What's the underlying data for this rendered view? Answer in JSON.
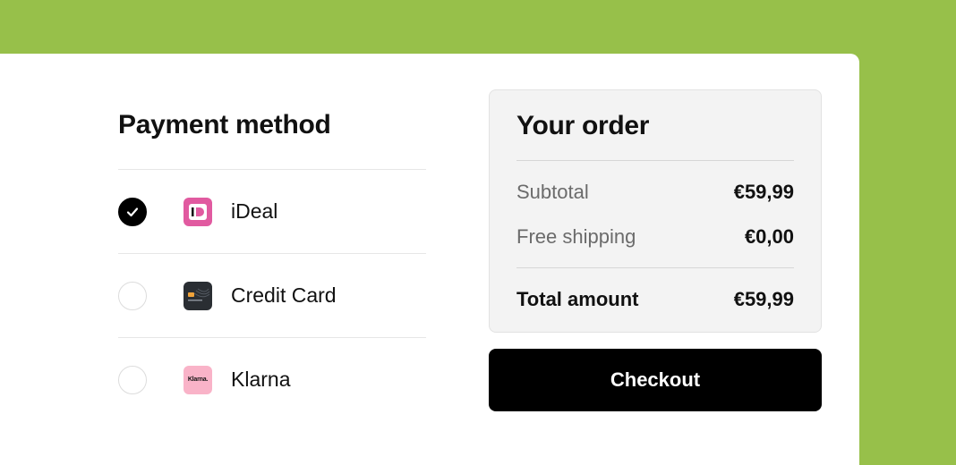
{
  "colors": {
    "background": "#97c04a",
    "ideal": "#e15aa0",
    "klarna": "#f9b3c8",
    "card": "#2a2e33"
  },
  "payment": {
    "title": "Payment method",
    "methods": [
      {
        "label": "iDeal",
        "icon": "ideal-logo-icon",
        "selected": true
      },
      {
        "label": "Credit Card",
        "icon": "credit-card-icon",
        "selected": false
      },
      {
        "label": "Klarna",
        "icon": "klarna-logo-icon",
        "selected": false,
        "logo_text": "Klarna."
      }
    ]
  },
  "order": {
    "title": "Your order",
    "subtotal_label": "Subtotal",
    "subtotal_value": "€59,99",
    "shipping_label": "Free shipping",
    "shipping_value": "€0,00",
    "total_label": "Total amount",
    "total_value": "€59,99"
  },
  "checkout_label": "Checkout"
}
